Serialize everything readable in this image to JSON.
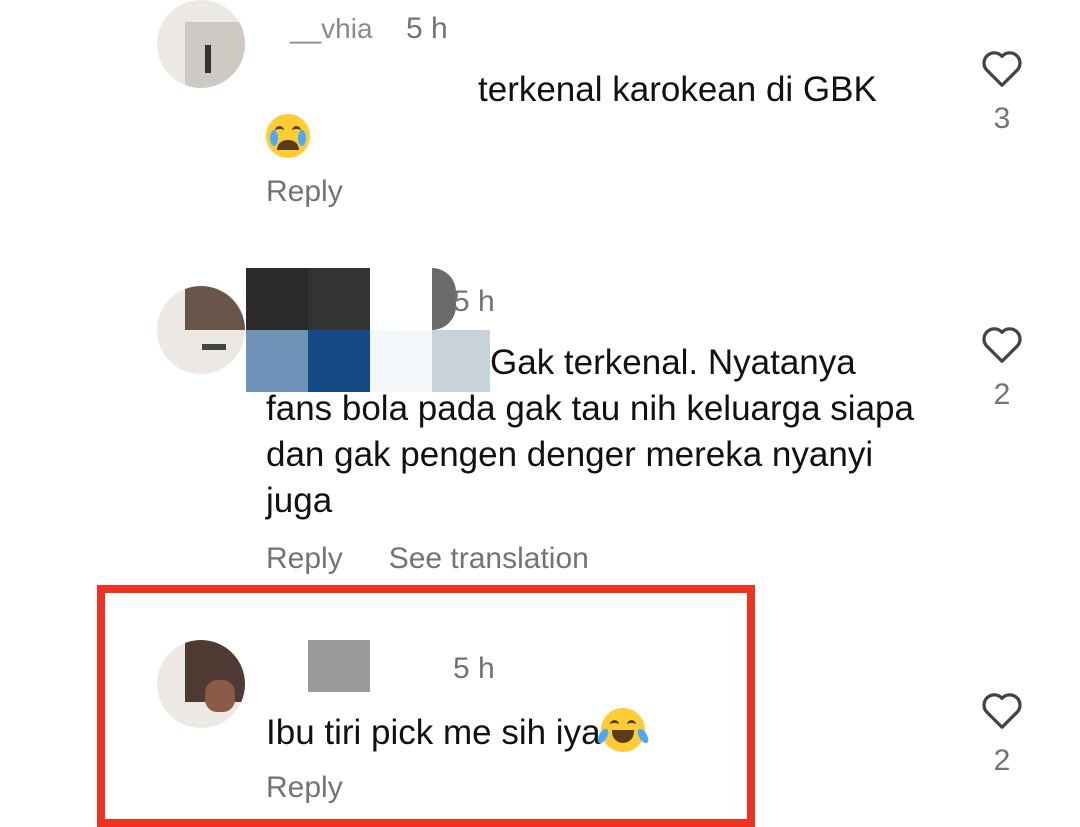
{
  "comments": [
    {
      "username": "__vhia",
      "time": "5 h",
      "text": "terkenal karokean di GBK",
      "emoji": "loudly-crying-face",
      "actions": {
        "reply": "Reply"
      },
      "likes": "3"
    },
    {
      "username": "",
      "time": "5 h",
      "text": "Gak terkenal. Nyatanya fans bola pada gak tau nih keluarga siapa dan gak pengen denger mereka nyanyi juga",
      "actions": {
        "reply": "Reply",
        "translate": "See translation"
      },
      "likes": "2"
    },
    {
      "username": "",
      "time": "5 h",
      "text": "Ibu tiri pick me sih iya",
      "emoji": "face-with-tears-of-joy",
      "actions": {
        "reply": "Reply"
      },
      "likes": "2",
      "highlighted": true
    }
  ],
  "colors": {
    "highlight": "#ee3322",
    "meta": "#737373",
    "text": "#111111"
  },
  "icons": {
    "like": "heart-outline-icon"
  }
}
